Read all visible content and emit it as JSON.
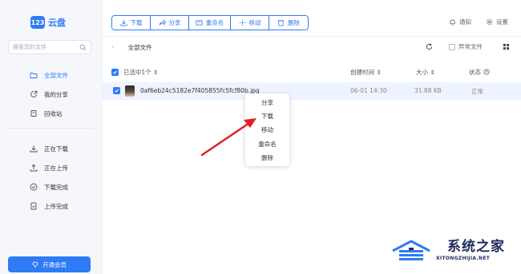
{
  "app": {
    "logo_mark": "123",
    "logo_text": "云盘"
  },
  "sidebar": {
    "search_placeholder": "搜索您的文件",
    "items": [
      {
        "label": "全部文件",
        "icon": "folder-icon",
        "active": true
      },
      {
        "label": "我的分享",
        "icon": "share-icon",
        "active": false
      },
      {
        "label": "回收站",
        "icon": "trash-icon",
        "active": false
      },
      {
        "label": "正在下载",
        "icon": "download-icon",
        "active": false
      },
      {
        "label": "正在上传",
        "icon": "upload-icon",
        "active": false
      },
      {
        "label": "下载完成",
        "icon": "check-circle-icon",
        "active": false
      },
      {
        "label": "上传完成",
        "icon": "file-check-icon",
        "active": false
      }
    ],
    "vip_label": "开通会员"
  },
  "toolbar": {
    "download": "下载",
    "share": "分享",
    "rename": "重命名",
    "move": "移动",
    "delete": "删除"
  },
  "top_right": {
    "notify": "通知",
    "settings": "设置"
  },
  "breadcrumb": {
    "path": "全部文件",
    "abnormal_label": "异常文件"
  },
  "table": {
    "selected_label": "已选中1个",
    "col_date": "创建时间",
    "col_size": "大小",
    "col_status": "状态"
  },
  "file": {
    "name": "0af6eb24c5182e7f405855fc5fcf80b.jpg",
    "date": "06-01 14:30",
    "size": "31.88 KB",
    "status": "正常"
  },
  "context_menu": {
    "items": [
      "分享",
      "下载",
      "移动",
      "重命名",
      "删除"
    ]
  },
  "watermark": {
    "cn": "系统之家",
    "en": "XITONGZHIJIA.NET"
  },
  "colors": {
    "accent": "#2f7bf6",
    "arrow": "#e02020"
  }
}
